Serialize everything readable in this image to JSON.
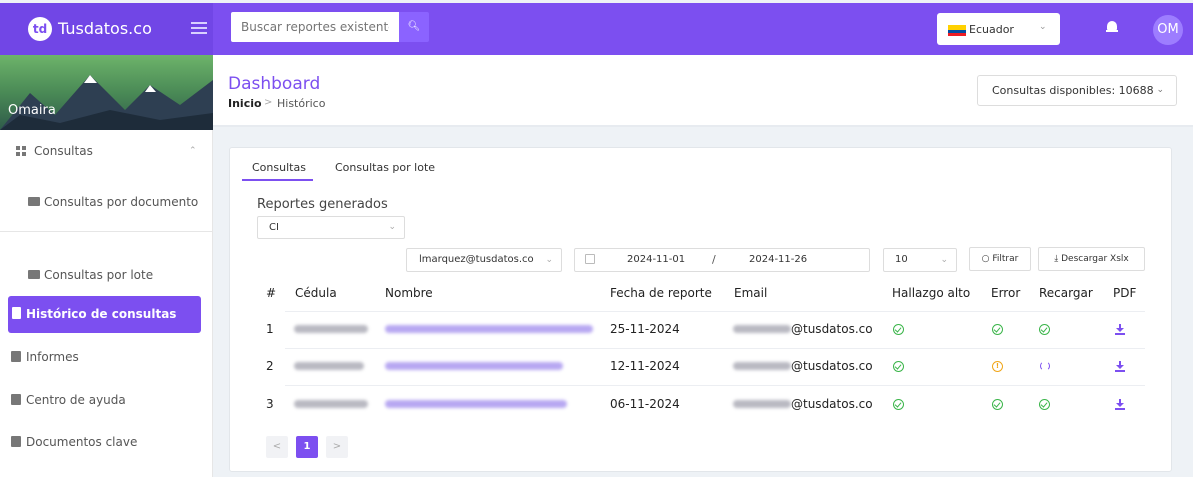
{
  "brand": {
    "logo_text": "td",
    "name": "Tusdatos.co"
  },
  "search": {
    "placeholder": "Buscar reportes existentes"
  },
  "country": {
    "label": "Ecuador"
  },
  "user": {
    "initials": "OM",
    "name": "Omaira"
  },
  "sidebar": {
    "section": "Consultas",
    "sub_items": [
      "Consultas por documento",
      "Consultas por lote"
    ],
    "active": "Histórico de consultas",
    "items": [
      "Informes",
      "Centro de ayuda",
      "Documentos clave"
    ]
  },
  "header": {
    "title": "Dashboard",
    "breadcrumb_home": "Inicio",
    "breadcrumb_current": "Histórico",
    "available": "Consultas disponibles: 10688"
  },
  "tabs": [
    "Consultas",
    "Consultas por lote"
  ],
  "filters": {
    "reportes_label": "Reportes generados",
    "tipo": "CI",
    "email": "lmarquez@tusdatos.co",
    "date_from": "2024-11-01",
    "date_sep": "/",
    "date_to": "2024-11-26",
    "page_size": "10",
    "filter_label": "Filtrar",
    "download_label": "Descargar Xslx"
  },
  "table": {
    "headers": [
      "#",
      "Cédula",
      "Nombre",
      "Fecha de reporte",
      "Email",
      "Hallazgo alto",
      "Error",
      "Recargar",
      "PDF"
    ],
    "rows": [
      {
        "num": "1",
        "fecha": "25-11-2024",
        "email": "@tusdatos.co",
        "hallazgo": "check",
        "error": "check",
        "recargar": "check",
        "pdf": "download"
      },
      {
        "num": "2",
        "fecha": "12-11-2024",
        "email": "@tusdatos.co",
        "hallazgo": "check",
        "error": "warning",
        "recargar": "reload",
        "pdf": "download"
      },
      {
        "num": "3",
        "fecha": "06-11-2024",
        "email": "@tusdatos.co",
        "hallazgo": "check",
        "error": "check",
        "recargar": "check",
        "pdf": "download"
      }
    ]
  },
  "pagination": {
    "prev": "<",
    "current": "1",
    "next": ">"
  },
  "colors": {
    "accent": "#7c4ff0",
    "ok": "#3bb54a",
    "warn": "#f0a61a"
  }
}
